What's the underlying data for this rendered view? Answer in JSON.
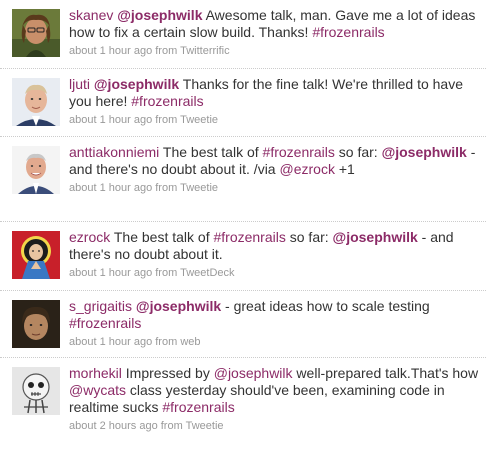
{
  "colors": {
    "link": "#8c2b67",
    "text": "#333333",
    "meta": "#999999",
    "divider": "#cccccc"
  },
  "tweets": [
    {
      "user": "skanev",
      "avatar_icon": "user-avatar-icon",
      "parts": [
        {
          "t": "mention",
          "v": "@josephwilk"
        },
        {
          "t": "text",
          "v": " Awesome talk, man. Gave me a lot of ideas how to fix a certain slow build. Thanks! "
        },
        {
          "t": "hashtag",
          "v": "#frozenrails"
        }
      ],
      "time": "about 1 hour ago",
      "from_label": "from",
      "source": "Twitterrific"
    },
    {
      "user": "ljuti",
      "avatar_icon": "user-avatar-icon",
      "parts": [
        {
          "t": "mention",
          "v": "@josephwilk"
        },
        {
          "t": "text",
          "v": " Thanks for the fine talk! We're thrilled to have you here! "
        },
        {
          "t": "hashtag",
          "v": "#frozenrails"
        }
      ],
      "time": "about 1 hour ago",
      "from_label": "from",
      "source": "Tweetie"
    },
    {
      "user": "anttiakonniemi",
      "avatar_icon": "user-avatar-icon",
      "parts": [
        {
          "t": "text",
          "v": " The best talk of "
        },
        {
          "t": "hashtag",
          "v": "#frozenrails"
        },
        {
          "t": "text",
          "v": " so far: "
        },
        {
          "t": "mention",
          "v": "@josephwilk"
        },
        {
          "t": "text",
          "v": " - and there's no doubt about it. /via "
        },
        {
          "t": "mention_plain",
          "v": "@ezrock"
        },
        {
          "t": "text",
          "v": " +1"
        }
      ],
      "time": "about 1 hour ago",
      "from_label": "from",
      "source": "Tweetie"
    },
    {
      "user": "ezrock",
      "avatar_icon": "user-avatar-icon",
      "parts": [
        {
          "t": "text",
          "v": " The best talk of "
        },
        {
          "t": "hashtag",
          "v": "#frozenrails"
        },
        {
          "t": "text",
          "v": " so far: "
        },
        {
          "t": "mention",
          "v": "@josephwilk"
        },
        {
          "t": "text",
          "v": " - and there's no doubt about it."
        }
      ],
      "time": "about 1 hour ago",
      "from_label": "from",
      "source": "TweetDeck"
    },
    {
      "user": "s_grigaitis",
      "avatar_icon": "user-avatar-icon",
      "parts": [
        {
          "t": "text",
          "v": " "
        },
        {
          "t": "mention",
          "v": "@josephwilk"
        },
        {
          "t": "text",
          "v": " - great ideas how to scale testing "
        },
        {
          "t": "hashtag",
          "v": "#frozenrails"
        }
      ],
      "time": "about 1 hour ago",
      "from_label": "from",
      "source": "web"
    },
    {
      "user": "morhekil",
      "avatar_icon": "user-avatar-icon",
      "parts": [
        {
          "t": "text",
          "v": " Impressed by "
        },
        {
          "t": "mention_plain",
          "v": "@josephwilk"
        },
        {
          "t": "text",
          "v": " well-prepared talk.That's how "
        },
        {
          "t": "mention_plain",
          "v": "@wycats"
        },
        {
          "t": "text",
          "v": " class yesterday should've been, examining code in realtime sucks "
        },
        {
          "t": "hashtag",
          "v": "#frozenrails"
        }
      ],
      "time": "about 2 hours ago",
      "from_label": "from",
      "source": "Tweetie"
    }
  ]
}
